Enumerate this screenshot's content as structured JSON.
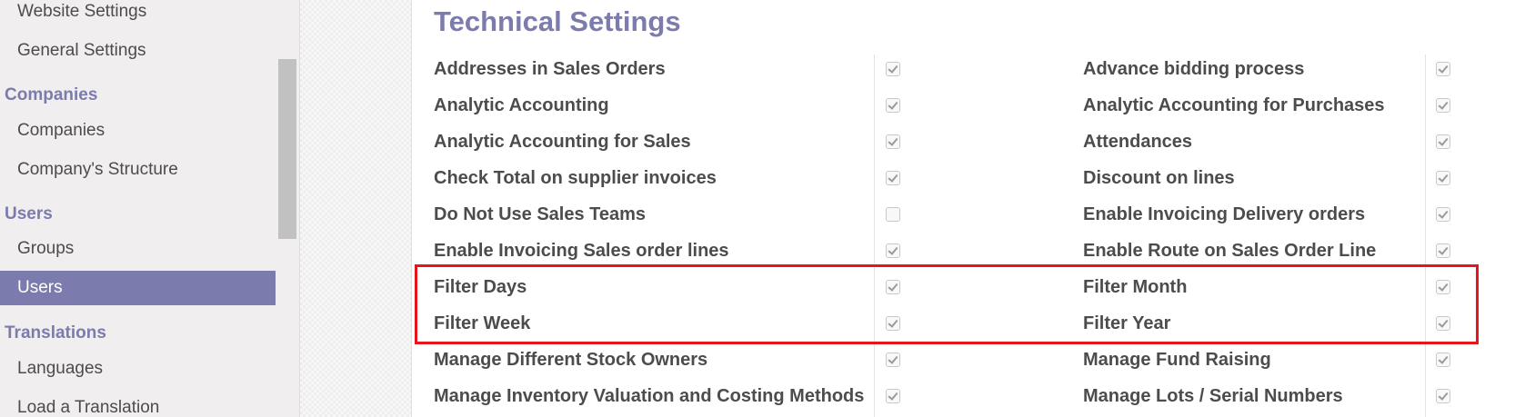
{
  "sidebar": {
    "items": [
      {
        "type": "item",
        "label": "Website Settings"
      },
      {
        "type": "item",
        "label": "General Settings"
      },
      {
        "type": "head",
        "label": "Companies"
      },
      {
        "type": "item",
        "label": "Companies"
      },
      {
        "type": "item",
        "label": "Company's Structure"
      },
      {
        "type": "head",
        "label": "Users"
      },
      {
        "type": "item",
        "label": "Groups"
      },
      {
        "type": "item",
        "label": "Users",
        "active": true
      },
      {
        "type": "head",
        "label": "Translations"
      },
      {
        "type": "item",
        "label": "Languages"
      },
      {
        "type": "item",
        "label": "Load a Translation"
      }
    ]
  },
  "main": {
    "title": "Technical Settings",
    "left_column": [
      {
        "label": "Addresses in Sales Orders",
        "checked": true
      },
      {
        "label": "Analytic Accounting",
        "checked": true
      },
      {
        "label": "Analytic Accounting for Sales",
        "checked": true
      },
      {
        "label": "Check Total on supplier invoices",
        "checked": true
      },
      {
        "label": "Do Not Use Sales Teams",
        "checked": false
      },
      {
        "label": "Enable Invoicing Sales order lines",
        "checked": true
      },
      {
        "label": "Filter Days",
        "checked": true
      },
      {
        "label": "Filter Week",
        "checked": true
      },
      {
        "label": "Manage Different Stock Owners",
        "checked": true
      },
      {
        "label": "Manage Inventory Valuation and Costing Methods",
        "checked": true
      }
    ],
    "right_column": [
      {
        "label": "Advance bidding process",
        "checked": true
      },
      {
        "label": "Analytic Accounting for Purchases",
        "checked": true
      },
      {
        "label": "Attendances",
        "checked": true
      },
      {
        "label": "Discount on lines",
        "checked": true
      },
      {
        "label": "Enable Invoicing Delivery orders",
        "checked": true
      },
      {
        "label": "Enable Route on Sales Order Line",
        "checked": true
      },
      {
        "label": "Filter Month",
        "checked": true
      },
      {
        "label": "Filter Year",
        "checked": true
      },
      {
        "label": "Manage Fund Raising",
        "checked": true
      },
      {
        "label": "Manage Lots / Serial Numbers",
        "checked": true
      }
    ]
  },
  "colors": {
    "accent": "#7c7bad",
    "highlight": "#e8141c"
  }
}
